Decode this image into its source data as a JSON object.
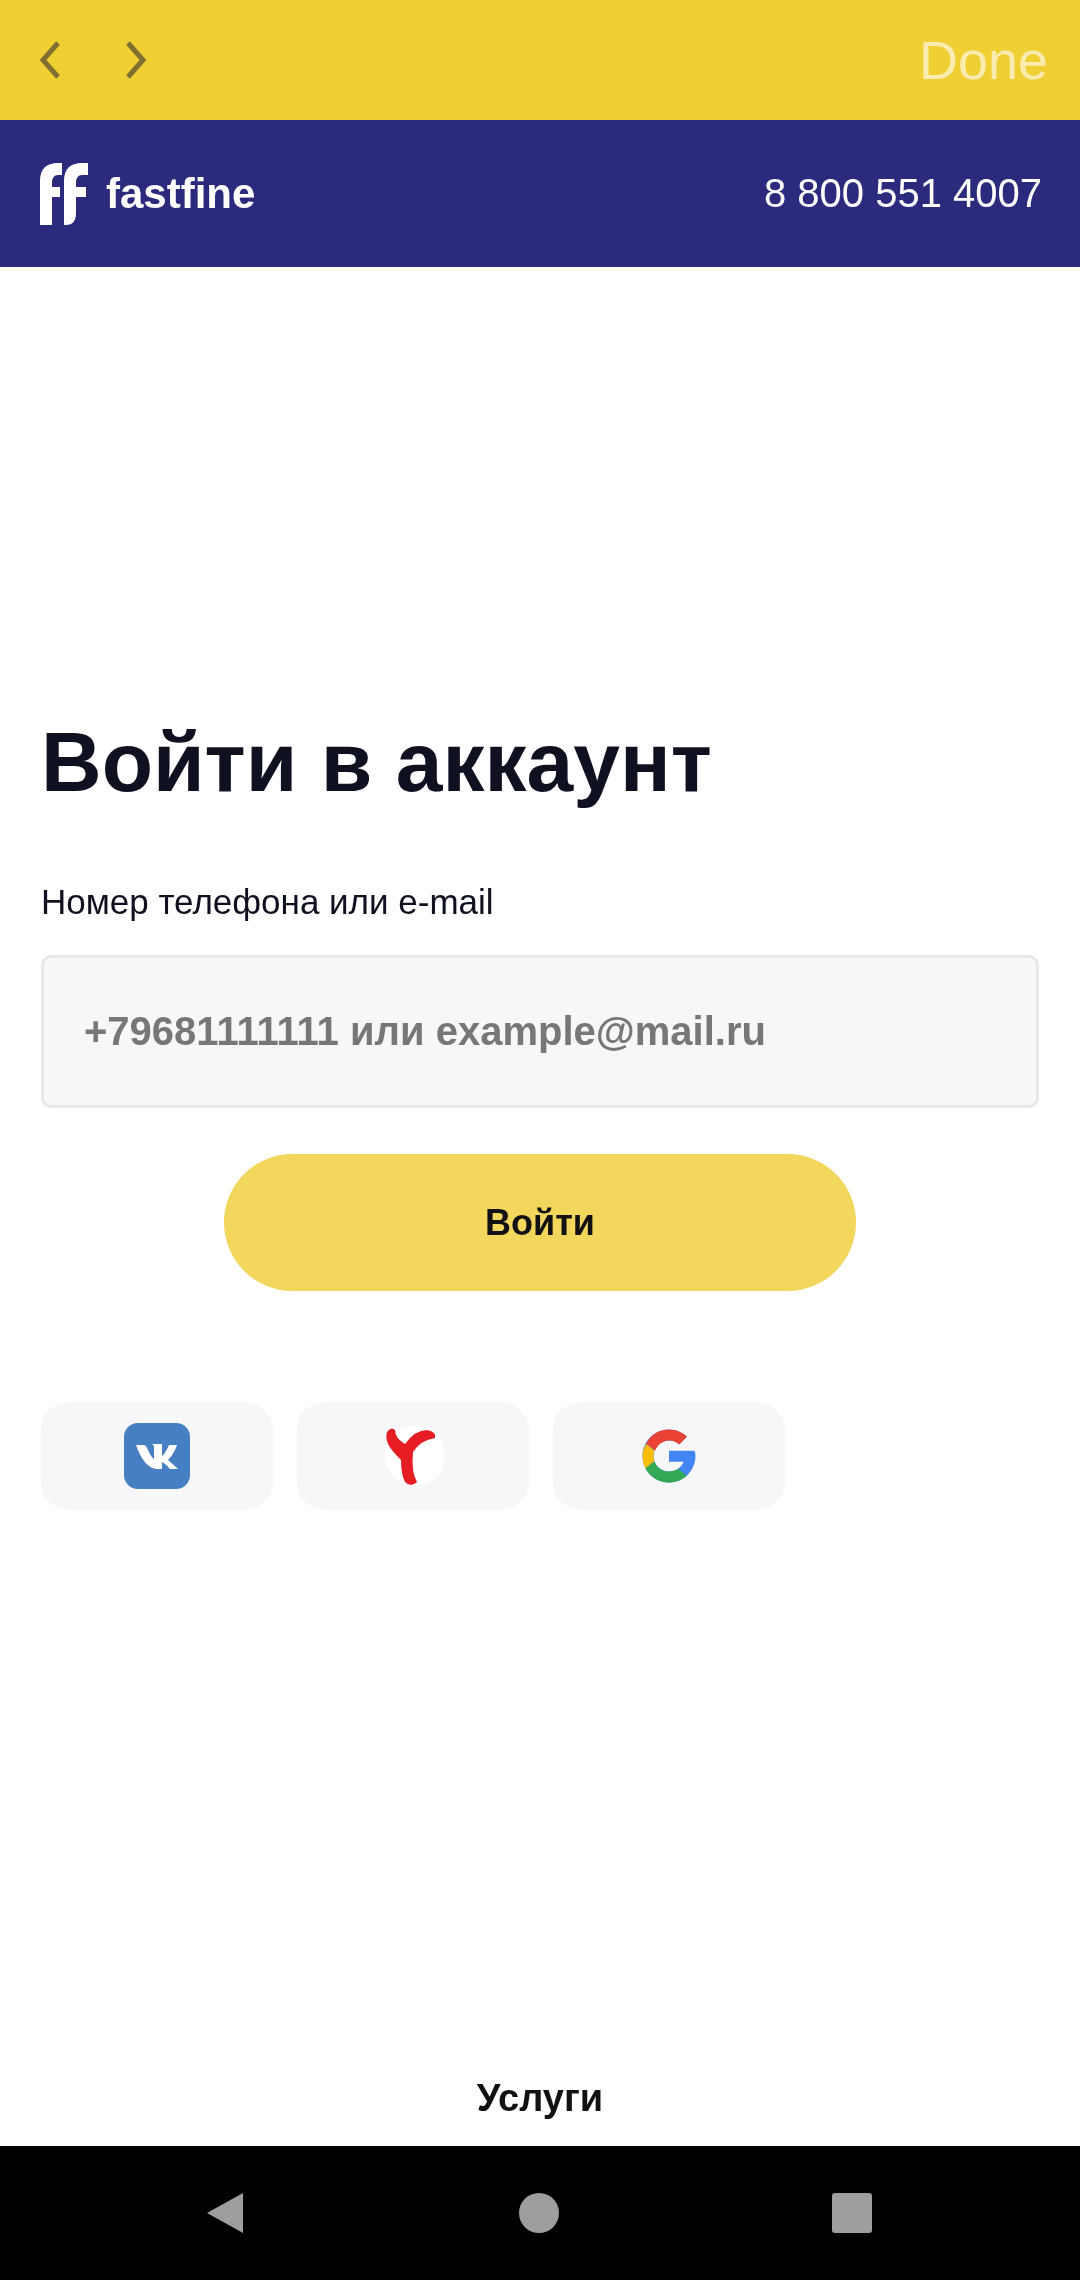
{
  "toolbar": {
    "done": "Done"
  },
  "header": {
    "brand": "fastfine",
    "phone": "8 800 551 4007"
  },
  "login": {
    "title": "Войти в аккаунт",
    "field_label": "Номер телефона или e-mail",
    "placeholder": "+79681111111 или example@mail.ru",
    "submit": "Войти"
  },
  "social_buttons": [
    {
      "kind": "vk"
    },
    {
      "kind": "yandex"
    },
    {
      "kind": "google"
    }
  ],
  "footer": {
    "link": "Услуги"
  }
}
